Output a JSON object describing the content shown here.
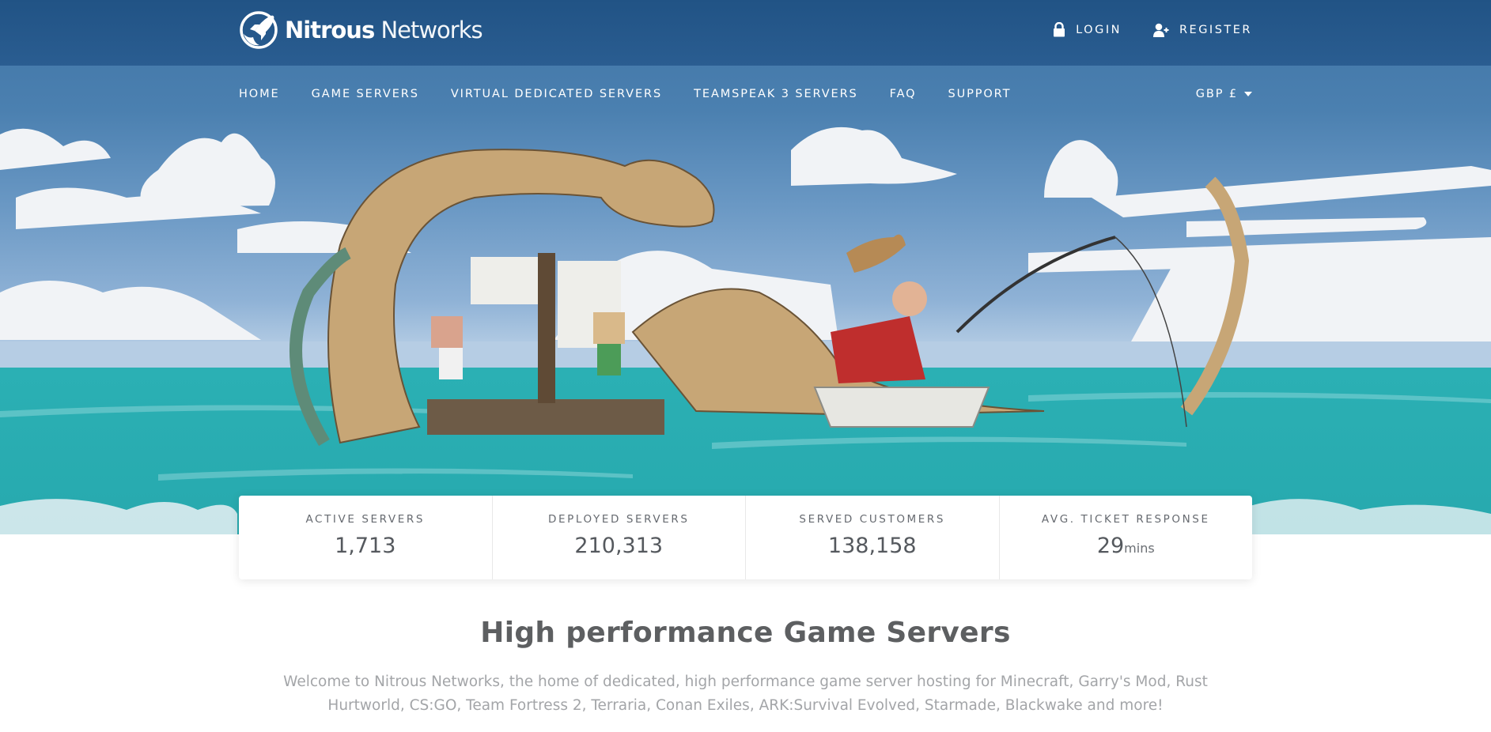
{
  "brand": {
    "name_bold": "Nitrous",
    "name_light": "Networks",
    "logo_icon": "rocket-globe-icon"
  },
  "account": {
    "login": {
      "label": "LOGIN",
      "icon": "lock-icon"
    },
    "register": {
      "label": "REGISTER",
      "icon": "add-user-icon"
    }
  },
  "nav": {
    "items": [
      {
        "label": "HOME"
      },
      {
        "label": "GAME SERVERS"
      },
      {
        "label": "VIRTUAL DEDICATED SERVERS"
      },
      {
        "label": "TEAMSPEAK 3 SERVERS"
      },
      {
        "label": "FAQ"
      },
      {
        "label": "SUPPORT"
      }
    ],
    "currency": {
      "label": "GBP £",
      "icon": "caret-down-icon"
    }
  },
  "hero": {
    "illustration": "sea-monster-fishing-scene"
  },
  "stats": [
    {
      "label": "ACTIVE SERVERS",
      "value": "1,713",
      "unit": ""
    },
    {
      "label": "DEPLOYED SERVERS",
      "value": "210,313",
      "unit": ""
    },
    {
      "label": "SERVED CUSTOMERS",
      "value": "138,158",
      "unit": ""
    },
    {
      "label": "AVG. TICKET RESPONSE",
      "value": "29",
      "unit": "mins"
    }
  ],
  "intro": {
    "title": "High performance Game Servers",
    "text": "Welcome to Nitrous Networks, the home of dedicated, high performance game server hosting for Minecraft, Garry's Mod, Rust Hurtworld, CS:GO, Team Fortress 2, Terraria, Conan Exiles, ARK:Survival Evolved, Starmade, Blackwake and more!"
  },
  "colors": {
    "header": "#215385",
    "sky": "#6a98c4",
    "sea": "#2bb0b4",
    "heading": "#5d5f61",
    "body_text": "#a3a5a8"
  }
}
